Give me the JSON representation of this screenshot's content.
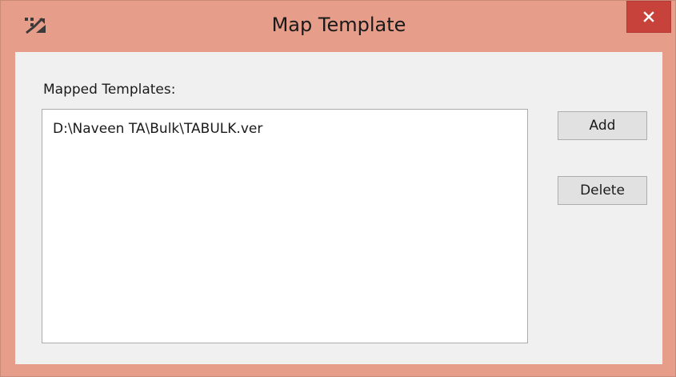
{
  "window": {
    "title": "Map Template",
    "app_icon": "app-icon",
    "close_icon": "close-icon",
    "close_color": "#c6423a",
    "frame_color": "#e69d89"
  },
  "dialog": {
    "label": "Mapped Templates:",
    "list_items": [
      "D:\\Naveen TA\\Bulk\\TABULK.ver"
    ],
    "add_label": "Add",
    "delete_label": "Delete"
  }
}
